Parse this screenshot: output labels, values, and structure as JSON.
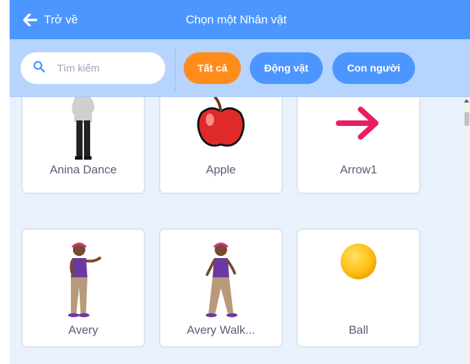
{
  "header": {
    "back_label": "Trở về",
    "title": "Chọn một Nhân vật",
    "back_icon": "arrow-left-icon"
  },
  "search": {
    "placeholder": "Tìm kiếm",
    "icon": "search-icon"
  },
  "filters": [
    {
      "label": "Tất cả",
      "active": true
    },
    {
      "label": "Động vật",
      "active": false
    },
    {
      "label": "Con người",
      "active": false
    }
  ],
  "sprites": [
    {
      "name": "Anina Dance"
    },
    {
      "name": "Apple"
    },
    {
      "name": "Arrow1"
    },
    {
      "name": "Avery"
    },
    {
      "name": "Avery Walk..."
    },
    {
      "name": "Ball"
    }
  ],
  "colors": {
    "header": "#4c97ff",
    "filter_bar": "#b6d4fe",
    "active_chip": "#ff8c1a",
    "chip": "#4c97ff",
    "background": "#e9f1fc"
  }
}
